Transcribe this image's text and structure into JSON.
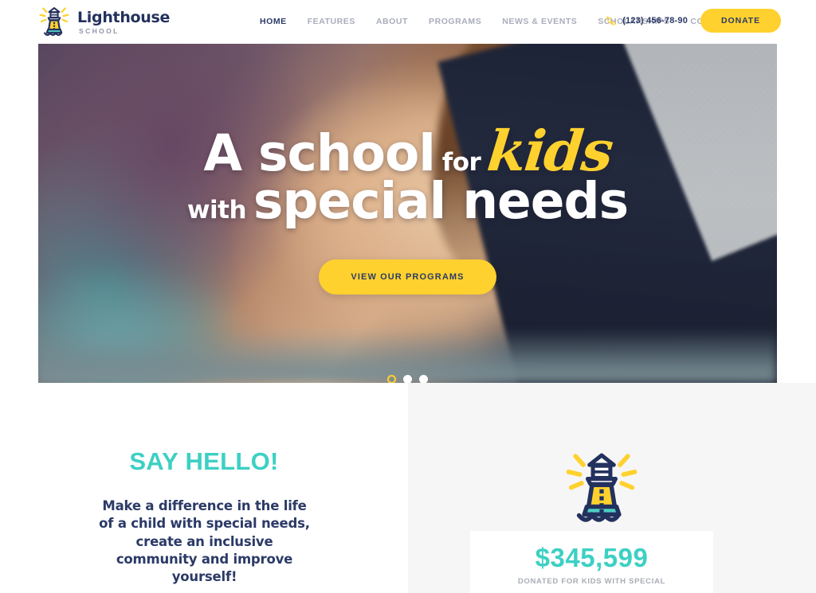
{
  "brand": {
    "name": "Lighthouse",
    "subtitle": "SCHOOL",
    "logo_icon": "lighthouse-icon",
    "colors": {
      "navy": "#2b3a67",
      "yellow": "#ffd12e",
      "teal": "#3dd0c4",
      "muted": "#a9adbb"
    }
  },
  "header": {
    "nav": [
      {
        "label": "HOME",
        "active": true
      },
      {
        "label": "FEATURES",
        "active": false
      },
      {
        "label": "ABOUT",
        "active": false
      },
      {
        "label": "PROGRAMS",
        "active": false
      },
      {
        "label": "NEWS & EVENTS",
        "active": false
      },
      {
        "label": "SCHOLARSHIPS",
        "active": false
      },
      {
        "label": "CONTACTS",
        "active": false
      }
    ],
    "phone_icon": "phone-icon",
    "phone": "(123) 456-78-90",
    "donate_label": "DONATE"
  },
  "hero": {
    "title_line1_a": "A school",
    "title_line1_b": "for",
    "title_line1_c": "kids",
    "title_line2_a": "with",
    "title_line2_b": "special needs",
    "cta_label": "VIEW OUR PROGRAMS",
    "slides": [
      {
        "index": "1",
        "active": true
      },
      {
        "index": "2",
        "active": false
      },
      {
        "index": "3",
        "active": false
      }
    ]
  },
  "intro": {
    "heading": "SAY HELLO!",
    "body": "Make a difference in the life of a child with special needs, create an inclusive community and improve yourself!"
  },
  "stats": {
    "icon": "lighthouse-icon",
    "amount": "$345,599",
    "label": "DONATED FOR KIDS WITH SPECIAL"
  }
}
